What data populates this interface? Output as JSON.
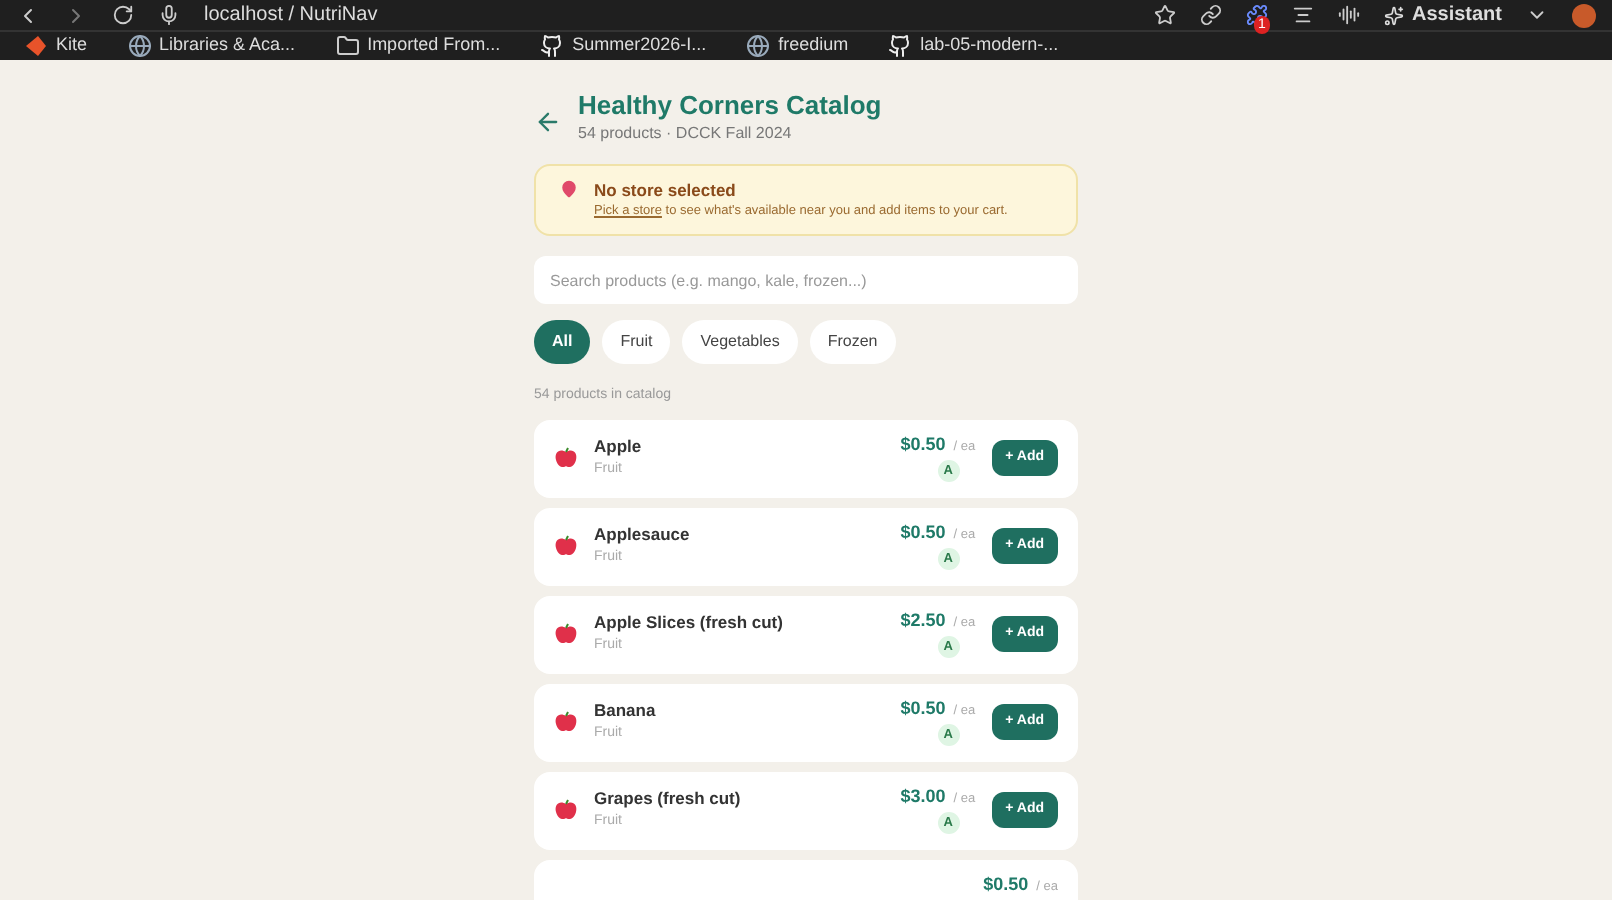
{
  "browser": {
    "address": "localhost / NutriNav",
    "extension_badge": "1",
    "assistant": "Assistant"
  },
  "bookmarks": [
    {
      "label": "Kite",
      "kind": "kite"
    },
    {
      "label": "Libraries & Aca...",
      "kind": "site"
    },
    {
      "label": "Imported From...",
      "kind": "folder"
    },
    {
      "label": "Summer2026-I...",
      "kind": "github"
    },
    {
      "label": "freedium",
      "kind": "site"
    },
    {
      "label": "lab-05-modern-...",
      "kind": "github"
    }
  ],
  "header": {
    "title": "Healthy Corners Catalog",
    "subtitle": "54 products · DCCK Fall 2024"
  },
  "alert": {
    "title": "No store selected",
    "link": "Pick a store",
    "text": " to see what's available near you and add items to your cart."
  },
  "search": {
    "placeholder": "Search products (e.g. mango, kale, frozen...)"
  },
  "filters": [
    {
      "label": "All",
      "selected": true
    },
    {
      "label": "Fruit",
      "selected": false
    },
    {
      "label": "Vegetables",
      "selected": false
    },
    {
      "label": "Frozen",
      "selected": false
    }
  ],
  "count": "54 products in catalog",
  "products": [
    {
      "name": "Apple",
      "category": "Fruit",
      "price": "$0.50",
      "unit": "/ ea",
      "grade": "A",
      "button": "+ Add"
    },
    {
      "name": "Applesauce",
      "category": "Fruit",
      "price": "$0.50",
      "unit": "/ ea",
      "grade": "A",
      "button": "+ Add"
    },
    {
      "name": "Apple Slices (fresh cut)",
      "category": "Fruit",
      "price": "$2.50",
      "unit": "/ ea",
      "grade": "A",
      "button": "+ Add"
    },
    {
      "name": "Banana",
      "category": "Fruit",
      "price": "$0.50",
      "unit": "/ ea",
      "grade": "A",
      "button": "+ Add"
    },
    {
      "name": "Grapes (fresh cut)",
      "category": "Fruit",
      "price": "$3.00",
      "unit": "/ ea",
      "grade": "A",
      "button": "+ Add"
    },
    {
      "price": "$0.50",
      "unit": "/ ea"
    }
  ]
}
